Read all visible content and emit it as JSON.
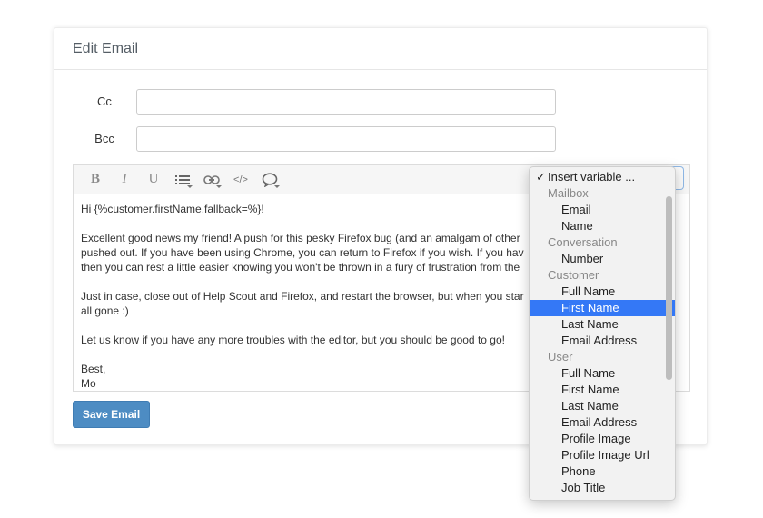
{
  "card": {
    "title": "Edit Email"
  },
  "fields": {
    "cc": {
      "label": "Cc",
      "value": ""
    },
    "bcc": {
      "label": "Bcc",
      "value": ""
    }
  },
  "toolbar": {
    "bold_glyph": "B",
    "italic_glyph": "I",
    "underline_glyph": "U",
    "code_glyph": "</>"
  },
  "body": {
    "lines": [
      "Hi {%customer.firstName,fallback=%}!",
      "Excellent good news my friend! A push for this pesky Firefox bug (and an amalgam of other",
      "pushed out. If you have been using Chrome, you can return to Firefox if you wish. If you hav",
      "then you can rest a little easier knowing you won't be thrown in a fury of frustration from the",
      "Just in case, close out of Help Scout and Firefox, and restart the browser, but when you star",
      "all gone :)",
      "Let us know if you have any more troubles with the editor, but you should be good to go!",
      "Best,",
      "Mo"
    ]
  },
  "save_label": "Save Email",
  "dropdown": {
    "check": "✓",
    "items": [
      {
        "kind": "first",
        "label": "Insert variable ..."
      },
      {
        "kind": "group",
        "label": "Mailbox"
      },
      {
        "kind": "opt",
        "label": "Email"
      },
      {
        "kind": "opt",
        "label": "Name"
      },
      {
        "kind": "group",
        "label": "Conversation"
      },
      {
        "kind": "opt",
        "label": "Number"
      },
      {
        "kind": "group",
        "label": "Customer"
      },
      {
        "kind": "opt",
        "label": "Full Name"
      },
      {
        "kind": "opt",
        "label": "First Name",
        "selected": true
      },
      {
        "kind": "opt",
        "label": "Last Name"
      },
      {
        "kind": "opt",
        "label": "Email Address"
      },
      {
        "kind": "group",
        "label": "User"
      },
      {
        "kind": "opt",
        "label": "Full Name"
      },
      {
        "kind": "opt",
        "label": "First Name"
      },
      {
        "kind": "opt",
        "label": "Last Name"
      },
      {
        "kind": "opt",
        "label": "Email Address"
      },
      {
        "kind": "opt",
        "label": "Profile Image"
      },
      {
        "kind": "opt",
        "label": "Profile Image Url"
      },
      {
        "kind": "opt",
        "label": "Phone"
      },
      {
        "kind": "opt",
        "label": "Job Title"
      }
    ]
  },
  "colors": {
    "primary_button": "#4d8cc3",
    "selected_option": "#3478f6"
  }
}
